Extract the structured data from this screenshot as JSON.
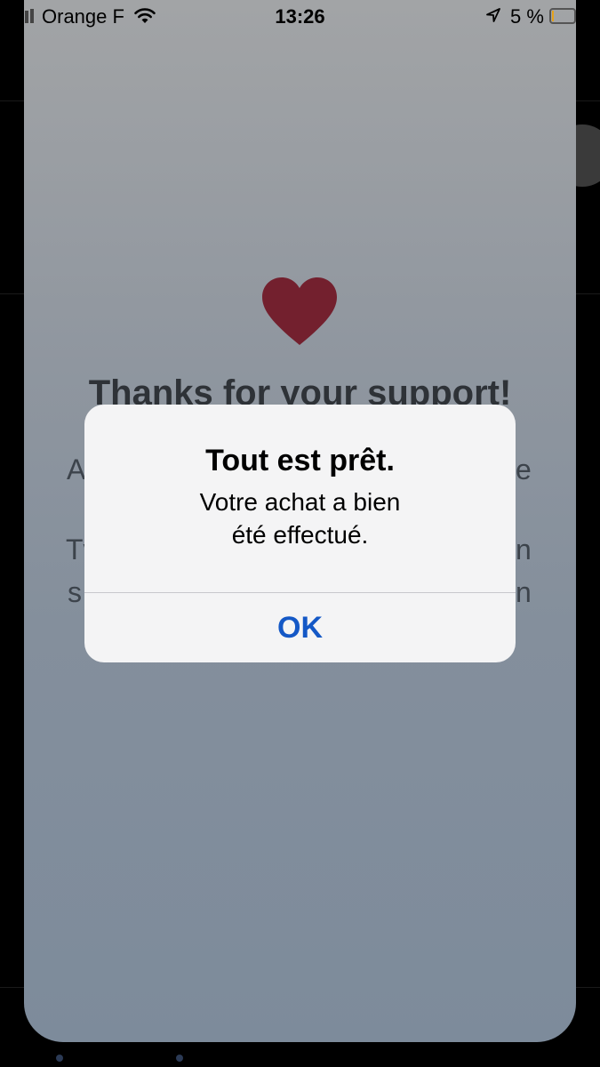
{
  "status_bar": {
    "carrier": "Orange F",
    "time": "13:26",
    "battery_percent": "5 %",
    "icons": [
      "signal-icon",
      "wifi-icon",
      "location-icon",
      "battery-icon"
    ]
  },
  "background": {
    "title": "Thanks for your support!",
    "partial_left": [
      "A",
      "Tv",
      "s"
    ],
    "partial_right": [
      "e",
      "n",
      "n"
    ],
    "heart_color": "#73202e"
  },
  "alert": {
    "title": "Tout est prêt.",
    "message_line1": "Votre achat a bien",
    "message_line2": "été effectué.",
    "ok_label": "OK",
    "ok_color": "#1458c6"
  }
}
